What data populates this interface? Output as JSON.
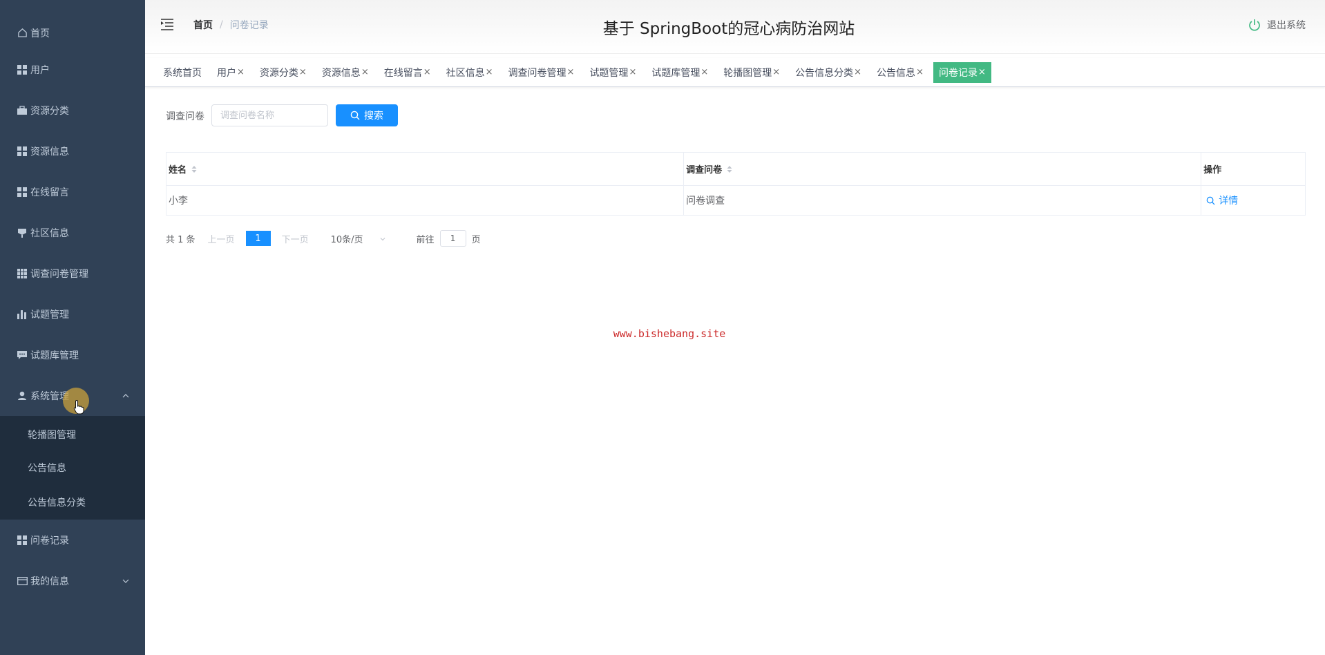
{
  "sidebar": {
    "items": [
      {
        "label": "首页",
        "icon": "home-icon"
      },
      {
        "label": "用户",
        "icon": "grid-icon"
      },
      {
        "label": "资源分类",
        "icon": "briefcase-icon"
      },
      {
        "label": "资源信息",
        "icon": "grid-icon"
      },
      {
        "label": "在线留言",
        "icon": "grid-icon"
      },
      {
        "label": "社区信息",
        "icon": "flag-icon"
      },
      {
        "label": "调查问卷管理",
        "icon": "apps-icon"
      },
      {
        "label": "试题管理",
        "icon": "bar-chart-icon"
      },
      {
        "label": "试题库管理",
        "icon": "message-icon"
      },
      {
        "label": "系统管理",
        "icon": "user-icon"
      }
    ],
    "system_submenu": [
      "轮播图管理",
      "公告信息",
      "公告信息分类"
    ],
    "after_items": [
      {
        "label": "问卷记录",
        "icon": "grid-icon"
      },
      {
        "label": "我的信息",
        "icon": "card-icon"
      }
    ]
  },
  "header": {
    "breadcrumb_home": "首页",
    "breadcrumb_separator": "/",
    "breadcrumb_current": "问卷记录",
    "title": "基于 SpringBoot的冠心病防治网站",
    "logout_label": "退出系统"
  },
  "tags": [
    {
      "label": "系统首页",
      "closable": false
    },
    {
      "label": "用户",
      "closable": true
    },
    {
      "label": "资源分类",
      "closable": true
    },
    {
      "label": "资源信息",
      "closable": true
    },
    {
      "label": "在线留言",
      "closable": true
    },
    {
      "label": "社区信息",
      "closable": true
    },
    {
      "label": "调查问卷管理",
      "closable": true
    },
    {
      "label": "试题管理",
      "closable": true
    },
    {
      "label": "试题库管理",
      "closable": true
    },
    {
      "label": "轮播图管理",
      "closable": true
    },
    {
      "label": "公告信息分类",
      "closable": true
    },
    {
      "label": "公告信息",
      "closable": true
    },
    {
      "label": "问卷记录",
      "closable": true,
      "active": true
    }
  ],
  "tag_close_glyph": "×",
  "search": {
    "label": "调查问卷",
    "placeholder": "调查问卷名称",
    "button_label": "搜索"
  },
  "table": {
    "headers": [
      "姓名",
      "调查问卷",
      "操作"
    ],
    "rows": [
      {
        "name": "小李",
        "survey": "问卷调查",
        "action": "详情"
      }
    ]
  },
  "pagination": {
    "total": "共 1 条",
    "prev": "上一页",
    "current_page": "1",
    "next": "下一页",
    "page_size": "10条/页",
    "goto_label": "前往",
    "goto_value": "1",
    "page_suffix": "页"
  },
  "watermark": "www.bishebang.site",
  "colors": {
    "sidebar_bg": "#304156",
    "submenu_bg": "#1f2d3d",
    "primary": "#1890ff",
    "active_tag": "#42b983",
    "watermark": "#cc2b2b"
  }
}
